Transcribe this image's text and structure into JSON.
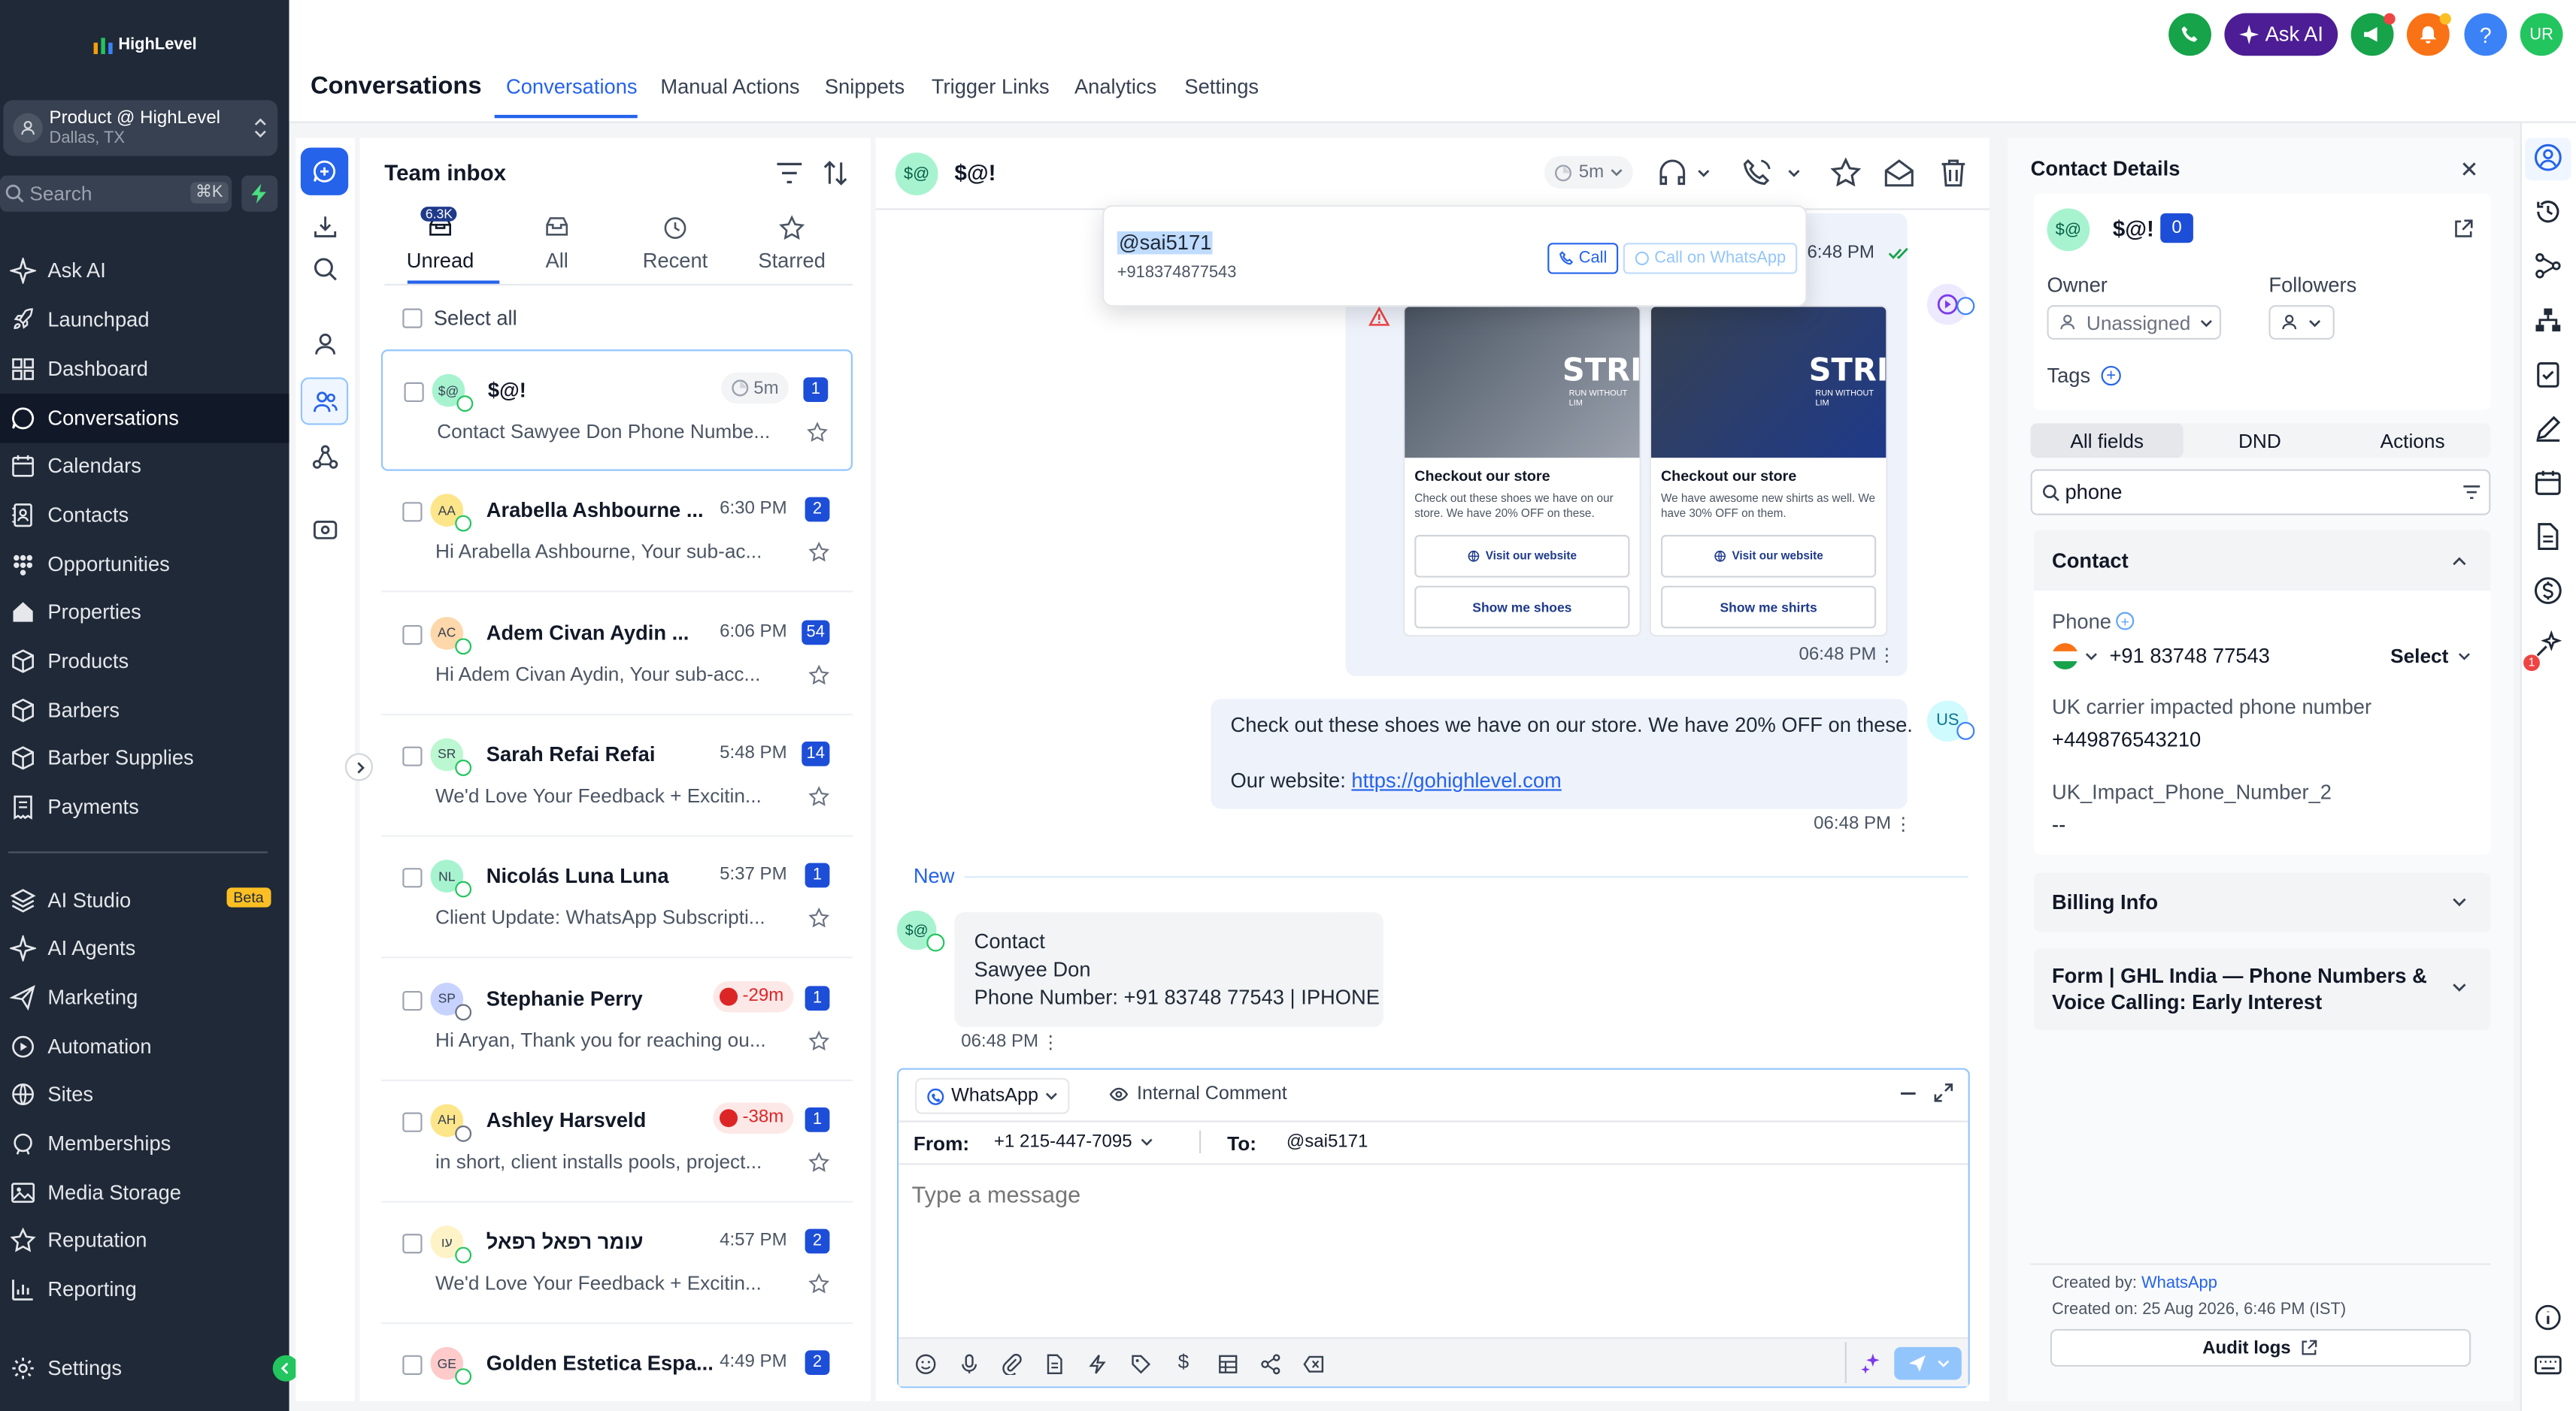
{
  "brand": "HighLevel",
  "account": {
    "name": "Product @ HighLevel",
    "location": "Dallas, TX"
  },
  "search": {
    "placeholder": "Search",
    "shortcut": "⌘K"
  },
  "nav": [
    {
      "label": "Ask AI",
      "icon": "sparkle-icon"
    },
    {
      "label": "Launchpad",
      "icon": "rocket-icon"
    },
    {
      "label": "Dashboard",
      "icon": "grid-icon"
    },
    {
      "label": "Conversations",
      "icon": "chat-icon"
    },
    {
      "label": "Calendars",
      "icon": "calendar-icon"
    },
    {
      "label": "Contacts",
      "icon": "contacts-icon"
    },
    {
      "label": "Opportunities",
      "icon": "funnel-icon"
    },
    {
      "label": "Properties",
      "icon": "home-icon"
    },
    {
      "label": "Products",
      "icon": "box-icon"
    },
    {
      "label": "Barbers",
      "icon": "cube-icon"
    },
    {
      "label": "Barber Supplies",
      "icon": "cube-icon"
    },
    {
      "label": "Payments",
      "icon": "receipt-icon"
    },
    {
      "label": "AI Studio",
      "icon": "layers-icon"
    },
    {
      "label": "AI Agents",
      "icon": "sparkle-icon"
    },
    {
      "label": "Marketing",
      "icon": "send-icon"
    },
    {
      "label": "Automation",
      "icon": "automation-icon"
    },
    {
      "label": "Sites",
      "icon": "globe-icon"
    },
    {
      "label": "Memberships",
      "icon": "graduation-icon"
    },
    {
      "label": "Media Storage",
      "icon": "image-icon"
    },
    {
      "label": "Reputation",
      "icon": "star-icon"
    },
    {
      "label": "Reporting",
      "icon": "chart-icon"
    },
    {
      "label": "Settings",
      "icon": "gear-icon"
    }
  ],
  "beta_label": "Beta",
  "page_title": "Conversations",
  "top_tabs": [
    "Conversations",
    "Manual Actions",
    "Snippets",
    "Trigger Links",
    "Analytics",
    "Settings"
  ],
  "ask_ai": "Ask AI",
  "user_initials": "UR",
  "inbox": {
    "title": "Team inbox",
    "filters": [
      {
        "label": "Unread",
        "count": "6.3K"
      },
      {
        "label": "All"
      },
      {
        "label": "Recent"
      },
      {
        "label": "Starred"
      }
    ],
    "select_all": "Select all",
    "items": [
      {
        "initials": "$@",
        "name": "$@!",
        "time": "",
        "status": "5m",
        "snippet": "Contact Sawyee Don Phone Numbe...",
        "badge": "1",
        "avatar_color": "#a7f3d0",
        "channel": "whatsapp"
      },
      {
        "initials": "AA",
        "name": "Arabella Ashbourne ...",
        "time": "6:30 PM",
        "snippet": "Hi Arabella Ashbourne, Your sub-ac...",
        "badge": "2",
        "avatar_color": "#fde68a",
        "channel": "whatsapp"
      },
      {
        "initials": "AC",
        "name": "Adem Civan Aydin ...",
        "time": "6:06 PM",
        "snippet": "Hi Adem Civan Aydin, Your sub-acc...",
        "badge": "54",
        "avatar_color": "#fed7aa",
        "channel": "whatsapp"
      },
      {
        "initials": "SR",
        "name": "Sarah Refai Refai",
        "time": "5:48 PM",
        "snippet": "We'd Love Your Feedback + Excitin...",
        "badge": "14",
        "avatar_color": "#bbf7d0",
        "channel": "whatsapp"
      },
      {
        "initials": "NL",
        "name": "Nicolás Luna Luna",
        "time": "5:37 PM",
        "snippet": "Client Update: WhatsApp Subscripti...",
        "badge": "1",
        "avatar_color": "#a7f3d0",
        "channel": "whatsapp"
      },
      {
        "initials": "SP",
        "name": "Stephanie Perry",
        "overdue": "-29m",
        "snippet": "Hi Aryan, Thank you for reaching ou...",
        "badge": "1",
        "avatar_color": "#c7d2fe",
        "channel": "email"
      },
      {
        "initials": "AH",
        "name": "Ashley Harsveld",
        "overdue": "-38m",
        "snippet": "in short, client installs pools, project...",
        "badge": "1",
        "avatar_color": "#fde68a",
        "channel": "email"
      },
      {
        "initials": "עו",
        "name": "עומר רפאל רפאל",
        "time": "4:57 PM",
        "snippet": "We'd Love Your Feedback + Excitin...",
        "badge": "2",
        "avatar_color": "#fef3c7",
        "channel": "whatsapp"
      },
      {
        "initials": "GE",
        "name": "Golden Estetica Espa...",
        "time": "4:49 PM",
        "snippet": "",
        "badge": "2",
        "avatar_color": "#fecaca",
        "channel": "whatsapp"
      }
    ]
  },
  "chat": {
    "contact_initials": "$@",
    "contact_name": "$@!",
    "snooze": "5m",
    "call_popup": {
      "handle": "@sai5171",
      "number": "+918374877543",
      "call": "Call",
      "call_wa": "Call on WhatsApp"
    },
    "partial_time": "6:48 PM",
    "carousel": [
      {
        "brand": "STRID",
        "tagline": "RUN WITHOUT LIM",
        "title": "Checkout our store",
        "desc": "Check out these shoes we have on our store. We have 20% OFF on these.",
        "btn1": "Visit our website",
        "btn2": "Show me shoes"
      },
      {
        "brand": "STRID",
        "tagline": "RUN WITHOUT LIM",
        "title": "Checkout our store",
        "desc": "We have awesome new shirts as well. We have 30% OFF on them.",
        "btn1": "Visit our website",
        "btn2": "Show me shirts"
      }
    ],
    "carousel_time": "06:48 PM",
    "outgoing": {
      "line1": "Check out these shoes we have on our store. We have 20% OFF on these.",
      "line2_prefix": "Our website: ",
      "link": "https://gohighlevel.com",
      "time": "06:48 PM",
      "initials": "US"
    },
    "new_label": "New",
    "incoming": {
      "initials": "$@",
      "line1": "Contact",
      "line2": "Sawyee Don",
      "line3": "Phone Number: +91 83748 77543 | IPHONE",
      "time": "06:48 PM"
    },
    "composer": {
      "channel": "WhatsApp",
      "internal": "Internal Comment",
      "from_label": "From:",
      "from_value": "+1 215-447-7095",
      "to_label": "To:",
      "to_value": "@sai5171",
      "placeholder": "Type a message"
    }
  },
  "details": {
    "title": "Contact Details",
    "initials": "$@",
    "name": "$@!",
    "count": "0",
    "owner_label": "Owner",
    "owner_value": "Unassigned",
    "followers_label": "Followers",
    "tags_label": "Tags",
    "tabs": [
      "All fields",
      "DND",
      "Actions"
    ],
    "search_value": "phone",
    "contact_section": "Contact",
    "phone_label": "Phone",
    "phone_value": "+91 83748 77543",
    "select": "Select",
    "uk_label": "UK carrier impacted phone number",
    "uk_value": "+449876543210",
    "uk2_label": "UK_Impact_Phone_Number_2",
    "uk2_value": "--",
    "billing": "Billing Info",
    "form_section": "Form | GHL India — Phone Numbers & Voice Calling: Early Interest",
    "created_by_label": "Created by:",
    "created_by_value": "WhatsApp",
    "created_on": "Created on: 25 Aug 2026, 6:46 PM (IST)",
    "audit": "Audit logs"
  },
  "rail_badge": "1"
}
